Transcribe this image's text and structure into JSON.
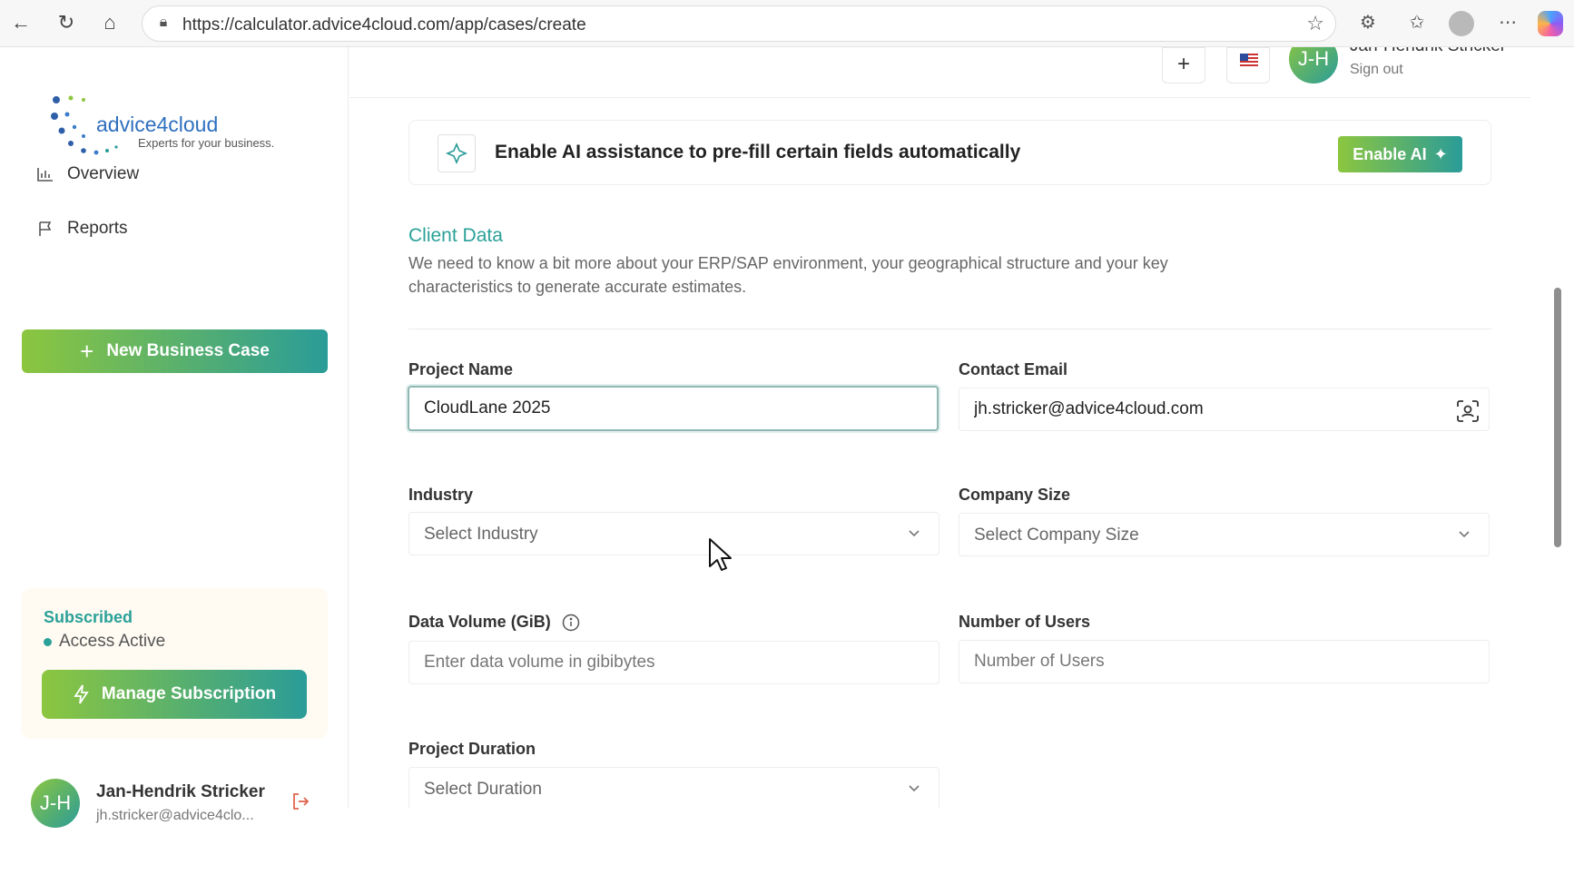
{
  "browser": {
    "url": "https://calculator.advice4cloud.com/app/cases/create"
  },
  "brand": {
    "name": "advice4cloud",
    "tagline": "Experts for your business."
  },
  "sidebar": {
    "items": [
      {
        "label": "Overview",
        "icon": "bar-chart-icon"
      },
      {
        "label": "Reports",
        "icon": "flag-icon"
      }
    ],
    "new_case_label": "New Business Case",
    "subscription": {
      "title": "Subscribed",
      "status": "Access Active",
      "manage_label": "Manage Subscription"
    },
    "user": {
      "initials": "J-H",
      "name": "Jan-Hendrik Stricker",
      "email": "jh.stricker@advice4clo..."
    }
  },
  "topbar": {
    "add_label": "+",
    "user_initials": "J-H",
    "user_name": "Jan-Hendrik Stricker",
    "signout_label": "Sign out"
  },
  "ai_banner": {
    "text": "Enable AI assistance to pre-fill certain fields automatically",
    "button_label": "Enable AI"
  },
  "client_data": {
    "title": "Client Data",
    "description": "We need to know a bit more about your ERP/SAP environment, your geographical structure and your key characteristics to generate accurate estimates.",
    "fields": {
      "project_name": {
        "label": "Project Name",
        "value": "CloudLane 2025"
      },
      "contact_email": {
        "label": "Contact Email",
        "value": "jh.stricker@advice4cloud.com"
      },
      "industry": {
        "label": "Industry",
        "placeholder": "Select Industry"
      },
      "company_size": {
        "label": "Company Size",
        "placeholder": "Select Company Size"
      },
      "data_volume": {
        "label": "Data Volume (GiB)",
        "placeholder": "Enter data volume in gibibytes"
      },
      "number_of_users": {
        "label": "Number of Users",
        "placeholder": "Number of Users"
      },
      "project_duration": {
        "label": "Project Duration",
        "placeholder": "Select Duration"
      }
    }
  },
  "colors": {
    "accent_green": "#8cc63f",
    "accent_teal": "#2a9c98",
    "section_title": "#2aa199",
    "logout_orange": "#e0664f"
  }
}
